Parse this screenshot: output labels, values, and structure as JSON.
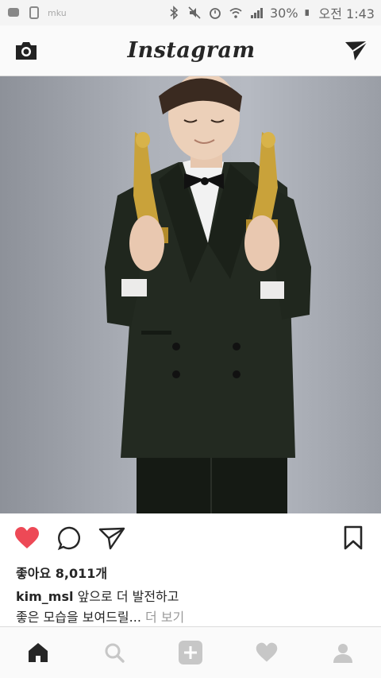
{
  "status_bar": {
    "left_icons": [
      "messenger-icon",
      "device-sync-icon"
    ],
    "carrier": "mku",
    "right_icons": [
      "bluetooth-icon",
      "mute-icon",
      "alarm-icon",
      "wifi-icon",
      "signal-icon",
      "battery-icon"
    ],
    "battery_percent": "30%",
    "time": "오전 1:43"
  },
  "header": {
    "title": "Instagram",
    "left_icon": "camera-icon",
    "right_icon": "direct-message-icon"
  },
  "post": {
    "image_icon": "photo",
    "actions": [
      "heart-icon",
      "comment-icon",
      "share-icon",
      "bookmark-icon"
    ],
    "likes": "좋아요 8,011개",
    "caption": {
      "username": "kim_msl",
      "text_line1": " 앞으로 더 발전하고",
      "text_line2": "좋은 모습을 보여드릴...",
      "more": " 더 보기"
    }
  },
  "bottom_nav": {
    "items": [
      "home-icon",
      "search-icon",
      "add-icon",
      "activity-icon",
      "profile-icon"
    ]
  },
  "colors": {
    "heart": "#ed4956",
    "text": "#262626",
    "muted": "#999999"
  }
}
